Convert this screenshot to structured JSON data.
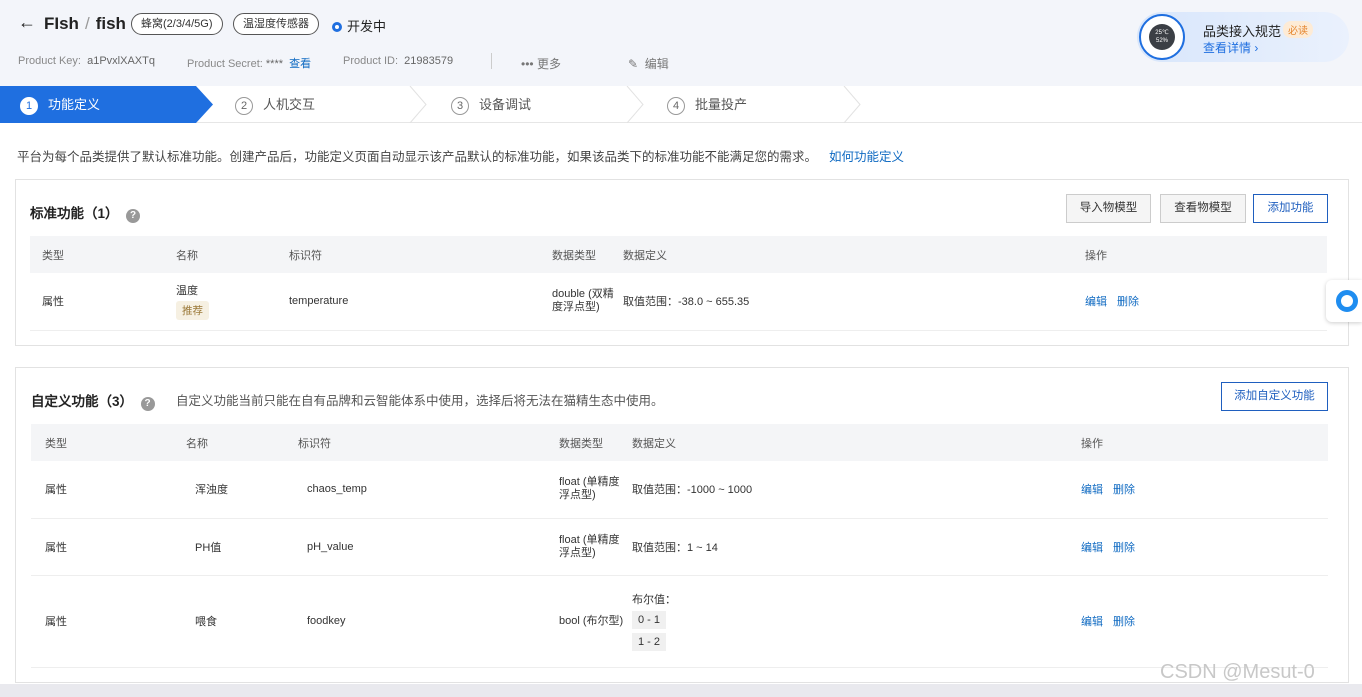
{
  "header": {
    "back_icon": "arrow-left",
    "title_main": "FIsh",
    "title_slash": "/",
    "title_sub": "fish",
    "tag_network": "蜂窝(2/3/4/5G)",
    "tag_category": "温湿度传感器",
    "status": "开发中",
    "product_key_label": "Product Key:",
    "product_key": "a1PvxlXAXTq",
    "product_secret_label": "Product Secret:",
    "product_secret": "****",
    "product_secret_view": "查看",
    "product_id_label": "Product ID:",
    "product_id": "21983579",
    "more": "更多",
    "edit": "编辑"
  },
  "promo": {
    "device_line1": "25℃",
    "device_line2": "52%",
    "title": "品类接入规范",
    "badge": "必读",
    "link": "查看详情 ›"
  },
  "steps": [
    {
      "num": "1",
      "label": "功能定义"
    },
    {
      "num": "2",
      "label": "人机交互"
    },
    {
      "num": "3",
      "label": "设备调试"
    },
    {
      "num": "4",
      "label": "批量投产"
    }
  ],
  "intro": {
    "text": "平台为每个品类提供了默认标准功能。创建产品后，功能定义页面自动显示该产品默认的标准功能，如果该品类下的标准功能不能满足您的需求。",
    "link": "如何功能定义"
  },
  "columns": {
    "type": "类型",
    "name": "名称",
    "identifier": "标识符",
    "datatype": "数据类型",
    "definition": "数据定义",
    "ops": "操作"
  },
  "ops": {
    "edit": "编辑",
    "delete": "删除"
  },
  "standard": {
    "title": "标准功能（1）",
    "btn_import": "导入物模型",
    "btn_view": "查看物模型",
    "btn_add": "添加功能",
    "rows": [
      {
        "type": "属性",
        "name": "温度",
        "tag": "推荐",
        "identifier": "temperature",
        "datatype": "double (双精度浮点型)",
        "definition": "取值范围：-38.0 ~ 655.35"
      }
    ]
  },
  "custom": {
    "title": "自定义功能（3）",
    "note": "自定义功能当前只能在自有品牌和云智能体系中使用，选择后将无法在猫精生态中使用。",
    "btn_add": "添加自定义功能",
    "rows": [
      {
        "type": "属性",
        "name": "浑浊度",
        "identifier": "chaos_temp",
        "datatype": "float (单精度浮点型)",
        "definition": "取值范围：-1000 ~ 1000"
      },
      {
        "type": "属性",
        "name": "PH值",
        "identifier": "pH_value",
        "datatype": "float (单精度浮点型)",
        "definition": "取值范围：1 ~ 14"
      },
      {
        "type": "属性",
        "name": "喂食",
        "identifier": "foodkey",
        "datatype": "bool (布尔型)",
        "definition_label": "布尔值：",
        "bool_values": [
          "0 - 1",
          "1 - 2"
        ]
      }
    ]
  },
  "watermark": "CSDN @Mesut-0",
  "colors": {
    "accent": "#1f6fe0",
    "link": "#0f6ac2",
    "header_bg": "#f3f5fa"
  }
}
